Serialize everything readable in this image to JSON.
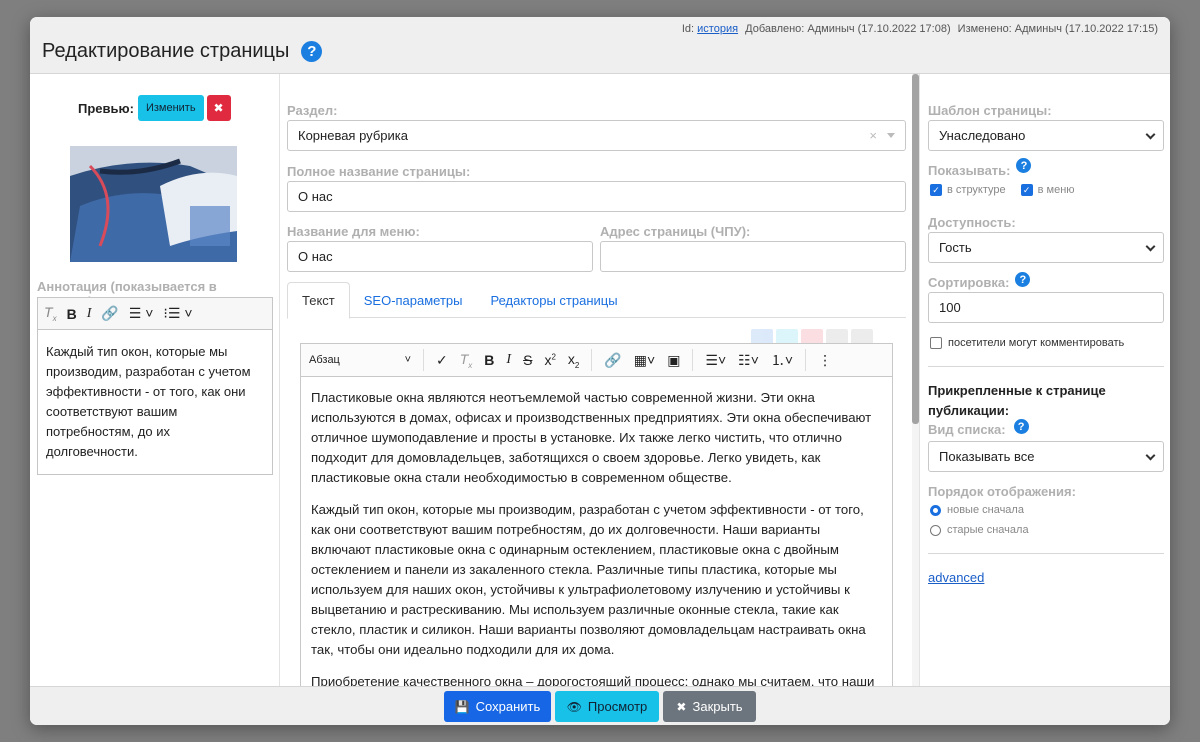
{
  "header": {
    "id_label": "Id:",
    "id_link": "история",
    "added": "Добавлено: Админыч (17.10.2022 17:08)",
    "changed": "Изменено: Админыч (17.10.2022 17:15)",
    "title": "Редактирование страницы",
    "help_glyph": "?"
  },
  "left": {
    "preview_label": "Превью:",
    "change_button": "Изменить",
    "delete_glyph": "✖",
    "annotation_label": "Аннотация (показывается в списках):",
    "annotation_text": "Каждый тип окон, которые мы производим, разработан с учетом эффективности - от того, как они соответствуют вашим потребностям, до их долговечности."
  },
  "middle": {
    "section_label": "Раздел:",
    "section_value": "Корневая рубрика",
    "section_clear": "×",
    "fullname_label": "Полное название страницы:",
    "fullname_value": "О нас",
    "menuname_label": "Название для меню:",
    "menuname_value": "О нас",
    "url_label": "Адрес страницы (ЧПУ):",
    "url_value": "",
    "tabs": [
      "Текст",
      "SEO-параметры",
      "Редакторы страницы"
    ],
    "format_select": "Абзац",
    "paragraphs": [
      "Пластиковые окна являются неотъемлемой частью современной жизни. Эти окна используются в домах, офисах и производственных предприятиях. Эти окна обеспечивают отличное шумоподавление и просты в установке. Их также легко чистить, что отлично подходит для домовладельцев, заботящихся о своем здоровье. Легко увидеть, как пластиковые окна стали необходимостью в современном обществе.",
      "Каждый тип окон, которые мы производим, разработан с учетом эффективности - от того, как они соответствуют вашим потребностям, до их долговечности. Наши варианты включают пластиковые окна с одинарным остеклением, пластиковые окна с двойным остеклением и панели из закаленного стекла. Различные типы пластика, которые мы используем для наших окон, устойчивы к ультрафиолетовому излучению и устойчивы к выцветанию и растрескиванию. Мы используем различные оконные стекла, такие как стекло, пластик и силикон. Наши варианты позволяют домовладельцам настраивать окна так, чтобы они идеально подходили для их дома.",
      "Приобретение качественного окна – дорогостоящий процесс; однако мы считаем, что наши"
    ]
  },
  "right": {
    "template_label": "Шаблон страницы:",
    "template_value": "Унаследовано",
    "show_label": "Показывать:",
    "show_structure": "в структуре",
    "show_menu": "в меню",
    "access_label": "Доступность:",
    "access_value": "Гость",
    "sort_label": "Сортировка:",
    "sort_value": "100",
    "comments_label": "посетители могут комментировать",
    "attached_title": "Прикрепленные к странице публикации:",
    "list_view_label": "Вид списка:",
    "list_view_value": "Показывать все",
    "order_label": "Порядок отображения:",
    "order_new": "новые сначала",
    "order_old": "старые сначала",
    "advanced_link": "advanced"
  },
  "footer": {
    "save": "Сохранить",
    "preview": "Просмотр",
    "close": "Закрыть"
  },
  "colors": {
    "primary": "#1666e6",
    "info": "#17c1e8",
    "secondary": "#6c757d",
    "danger": "#e02a40"
  }
}
